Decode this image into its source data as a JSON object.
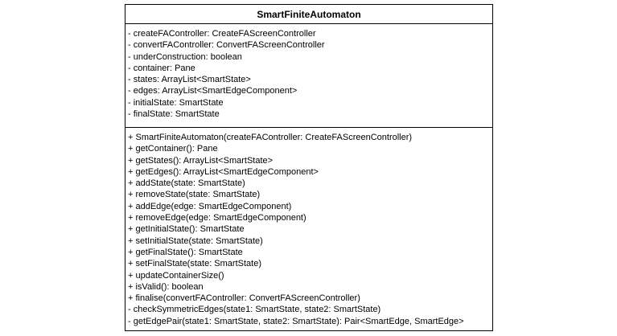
{
  "uml_class": {
    "name": "SmartFiniteAutomaton",
    "attributes": [
      "- createFAController: CreateFAScreenController",
      "- convertFAController: ConvertFAScreenController",
      "- underConstruction: boolean",
      "- container: Pane",
      "- states: ArrayList<SmartState>",
      "- edges: ArrayList<SmartEdgeComponent>",
      "- initialState: SmartState",
      "- finalState: SmartState"
    ],
    "methods": [
      "+ SmartFiniteAutomaton(createFAController: CreateFAScreenController)",
      "+ getContainer(): Pane",
      "+ getStates(): ArrayList<SmartState>",
      "+ getEdges(): ArrayList<SmartEdgeComponent>",
      "+ addState(state: SmartState)",
      "+ removeState(state: SmartState)",
      "+ addEdge(edge: SmartEdgeComponent)",
      "+ removeEdge(edge: SmartEdgeComponent)",
      "+ getInitialState(): SmartState",
      "+ setInitialState(state: SmartState)",
      "+ getFinalState(): SmartState",
      "+ setFinalState(state: SmartState)",
      "+ updateContainerSize()",
      "+ isValid(): boolean",
      "+ finalise(convertFAController: ConvertFAScreenController)",
      "- checkSymmetricEdges(state1: SmartState, state2: SmartState)",
      "- getEdgePair(state1: SmartState, state2: SmartState): Pair<SmartEdge, SmartEdge>"
    ]
  }
}
